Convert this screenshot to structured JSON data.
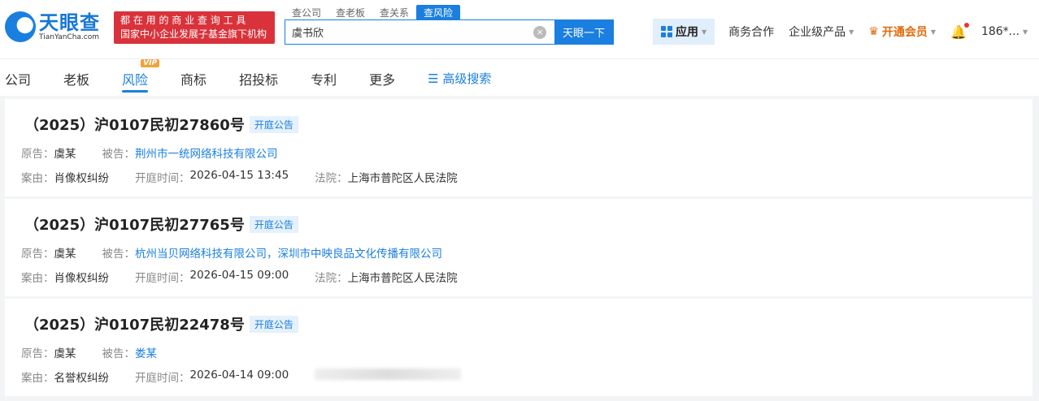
{
  "logo": {
    "cn": "天眼查",
    "en": "TianYanCha.com"
  },
  "slogan": [
    "都 在 用 的 商 业 查 询 工 具",
    "国家中小企业发展子基金旗下机构"
  ],
  "search_tabs": [
    "查公司",
    "查老板",
    "查关系",
    "查风险"
  ],
  "search": {
    "value": "虞书欣",
    "button": "天眼一下"
  },
  "right_nav": {
    "app": "应用",
    "business": "商务合作",
    "enterprise": "企业级产品",
    "vip": "开通会员",
    "user": "186*..."
  },
  "nav": {
    "items": [
      "公司",
      "老板",
      "风险",
      "商标",
      "招投标",
      "专利",
      "更多"
    ],
    "vip_badge": "VIP",
    "advanced": "高级搜索"
  },
  "labels": {
    "plaintiff": "原告：",
    "defendant": "被告：",
    "cause": "案由：",
    "time": "开庭时间：",
    "court": "法院："
  },
  "records": [
    {
      "case": "（2025）沪0107民初27860号",
      "tag": "开庭公告",
      "plaintiff": "虞某",
      "defendant": "荆州市一统网络科技有限公司",
      "cause": "肖像权纠纷",
      "time": "2026-04-15 13:45",
      "court": "上海市普陀区人民法院"
    },
    {
      "case": "（2025）沪0107民初27765号",
      "tag": "开庭公告",
      "plaintiff": "虞某",
      "defendant": "杭州当贝网络科技有限公司，深圳市中映良品文化传播有限公司",
      "cause": "肖像权纠纷",
      "time": "2026-04-15 09:00",
      "court": "上海市普陀区人民法院"
    },
    {
      "case": "（2025）沪0107民初22478号",
      "tag": "开庭公告",
      "plaintiff": "虞某",
      "defendant": "娄某",
      "cause": "名誉权纠纷",
      "time": "2026-04-14 09:00"
    }
  ]
}
